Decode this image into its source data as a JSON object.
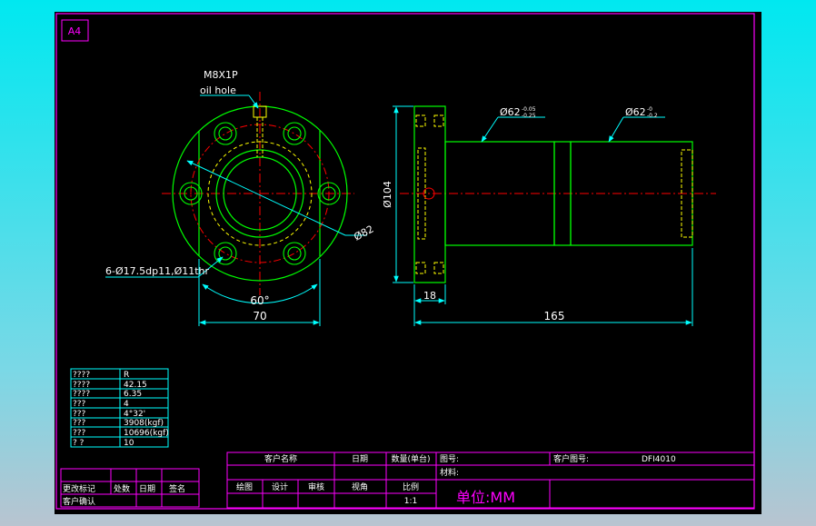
{
  "sheet": {
    "size_label": "A4"
  },
  "front_view": {
    "oil_hole_thread": "M8X1P",
    "oil_hole_label": "oil hole",
    "hole_note": "6-Ø17.5dp11,Ø11thr",
    "angle": "60°",
    "width_dim": "70",
    "pcd_dim": "Ø82"
  },
  "side_view": {
    "flange_dia": "Ø104",
    "body_dia_1": "Ø62",
    "tol_1_upper": "-0.05",
    "tol_1_lower": "-0.25",
    "body_dia_2": "Ø62",
    "tol_2_upper": "-0",
    "tol_2_lower": "-0.2",
    "flange_thk": "18",
    "length": "165"
  },
  "spec_table": [
    {
      "key": "????",
      "value": "R"
    },
    {
      "key": "????",
      "value": "42.15"
    },
    {
      "key": "????",
      "value": "6.35"
    },
    {
      "key": "???",
      "value": "4"
    },
    {
      "key": "???",
      "value": "4°32'"
    },
    {
      "key": "???",
      "value": "3908(kgf)"
    },
    {
      "key": "???",
      "value": "10696(kgf)"
    },
    {
      "key": "?  ?",
      "value": "10"
    }
  ],
  "revision_block": {
    "change_mark": "更改标记",
    "location": "处数",
    "date": "日期",
    "sign": "签名",
    "customer_confirm": "客户确认"
  },
  "title_block": {
    "customer_name": "客户名称",
    "date": "日期",
    "qty": "数量(单台)",
    "drawing_no_label": "图号:",
    "customer_drawing_label": "客户图号:",
    "customer_drawing_value": "DFI4010",
    "material_label": "材料:",
    "drawn": "绘图",
    "design": "设计",
    "review": "审核",
    "view_angle": "视角",
    "scale_label": "比例",
    "scale_value": "1:1",
    "unit": "单位:MM"
  },
  "colors": {
    "frame": "#ff00ff",
    "outline": "#00ff00",
    "center": "#ff0000",
    "dimension": "#00ffff",
    "text": "#ffffff",
    "hidden": "#ffff00",
    "unit_text": "#ff00ff"
  }
}
